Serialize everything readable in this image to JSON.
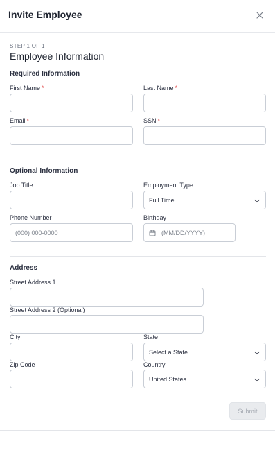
{
  "modal": {
    "title": "Invite Employee",
    "close_icon": "close-icon"
  },
  "step": {
    "indicator": "STEP 1 OF 1",
    "heading": "Employee Information"
  },
  "required": {
    "section_label": "Required Information",
    "first_name_label": "First Name",
    "last_name_label": "Last Name",
    "email_label": "Email",
    "ssn_label": "SSN",
    "required_marker": "*",
    "first_name_value": "",
    "last_name_value": "",
    "email_value": "",
    "ssn_value": ""
  },
  "optional": {
    "section_label": "Optional Information",
    "job_title_label": "Job Title",
    "job_title_value": "",
    "employment_type_label": "Employment Type",
    "employment_type_value": "Full Time",
    "phone_label": "Phone Number",
    "phone_placeholder": "(000) 000-0000",
    "birthday_label": "Birthday",
    "birthday_placeholder": "(MM/DD/YYYY)",
    "birthday_icon": "calendar-icon"
  },
  "address": {
    "section_label": "Address",
    "street1_label": "Street Address 1",
    "street1_value": "",
    "street2_label": "Street Address 2 (Optional)",
    "street2_value": "",
    "city_label": "City",
    "city_value": "",
    "state_label": "State",
    "state_value": "Select a State",
    "zip_label": "Zip Code",
    "zip_value": "",
    "country_label": "Country",
    "country_value": "United States"
  },
  "footer": {
    "submit_label": "Submit",
    "submit_enabled": false
  },
  "colors": {
    "required_marker": "#dd3333",
    "border": "#c9ced6",
    "disabled_button_bg": "#e9ebee",
    "disabled_button_text": "#a6abb3"
  }
}
